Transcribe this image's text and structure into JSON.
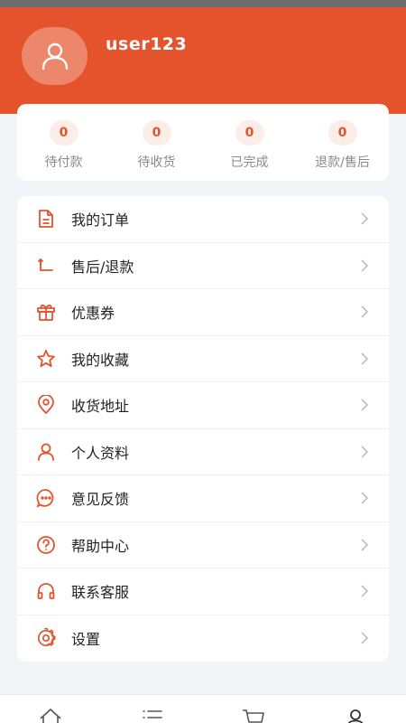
{
  "profile": {
    "username": "user123"
  },
  "orders": [
    {
      "count": "0",
      "label": "待付款"
    },
    {
      "count": "0",
      "label": "待收货"
    },
    {
      "count": "0",
      "label": "已完成"
    },
    {
      "count": "0",
      "label": "退款/售后"
    }
  ],
  "menu": [
    {
      "label": "我的订单",
      "icon": "document-icon"
    },
    {
      "label": "售后/退款",
      "icon": "return-arrow-icon"
    },
    {
      "label": "优惠券",
      "icon": "gift-icon"
    },
    {
      "label": "我的收藏",
      "icon": "star-icon"
    },
    {
      "label": "收货地址",
      "icon": "location-pin-icon"
    },
    {
      "label": "个人资料",
      "icon": "user-icon"
    },
    {
      "label": "意见反馈",
      "icon": "chat-bubble-icon"
    },
    {
      "label": "帮助中心",
      "icon": "question-icon"
    },
    {
      "label": "联系客服",
      "icon": "headset-icon"
    },
    {
      "label": "设置",
      "icon": "gear-icon"
    }
  ],
  "tabbar": [
    "home-icon",
    "list-icon",
    "cart-icon",
    "user-icon"
  ],
  "colors": {
    "accent": "#e5532d",
    "badge_bg": "#fbeee9",
    "page_bg": "#f3f4f8"
  }
}
